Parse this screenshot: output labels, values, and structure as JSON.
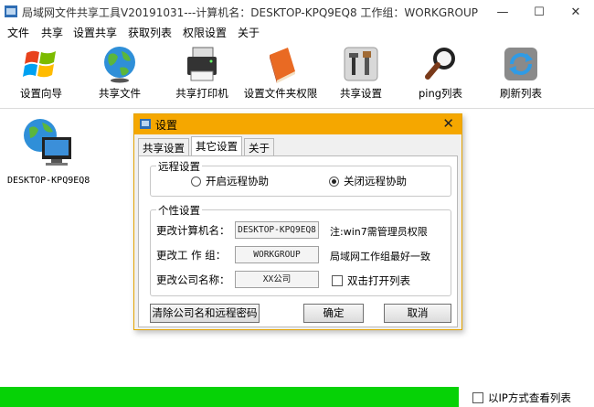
{
  "window": {
    "title": "局域网文件共享工具V20191031---计算机名：DESKTOP-KPQ9EQ8  工作组：WORKGROUP",
    "minimize": "—",
    "maximize": "☐",
    "close": "✕"
  },
  "menu": [
    "文件",
    "共享",
    "设置共享",
    "获取列表",
    "权限设置",
    "关于"
  ],
  "toolbar": [
    {
      "label": "设置向导",
      "icon": "windows-logo-icon"
    },
    {
      "label": "共享文件",
      "icon": "globe-icon"
    },
    {
      "label": "共享打印机",
      "icon": "printer-icon"
    },
    {
      "label": "设置文件夹权限",
      "icon": "book-icon"
    },
    {
      "label": "共享设置",
      "icon": "tools-icon"
    },
    {
      "label": "ping列表",
      "icon": "magnifier-icon"
    },
    {
      "label": "刷新列表",
      "icon": "refresh-icon"
    }
  ],
  "computer": {
    "name": "DESKTOP-KPQ9EQ8",
    "icon": "network-computer-icon"
  },
  "dialog": {
    "title": "设置",
    "close": "✕",
    "tabs": [
      "共享设置",
      "其它设置",
      "关于"
    ],
    "active_tab": 1,
    "remote_group": {
      "title": "远程设置",
      "options": [
        {
          "label": "开启远程协助",
          "checked": false
        },
        {
          "label": "关闭远程协助",
          "checked": true
        }
      ]
    },
    "personal_group": {
      "title": "个性设置",
      "computer_name": {
        "label": "更改计算机名：",
        "value": "DESKTOP-KPQ9EQ8",
        "note": "注:win7需管理员权限"
      },
      "workgroup": {
        "label": "更改工 作 组：",
        "value": "WORKGROUP",
        "note": "局域网工作组最好一致"
      },
      "company": {
        "label": "更改公司名称：",
        "value": "XX公司",
        "checkbox": "双击打开列表",
        "checked": false
      }
    },
    "buttons": {
      "clear": "清除公司名和远程密码",
      "ok": "确定",
      "cancel": "取消"
    }
  },
  "status": {
    "progress": 1.0,
    "ip_view_label": "以IP方式查看列表",
    "ip_view_checked": false
  },
  "colors": {
    "dialog_title": "#f5a700",
    "progress": "#06d206"
  }
}
